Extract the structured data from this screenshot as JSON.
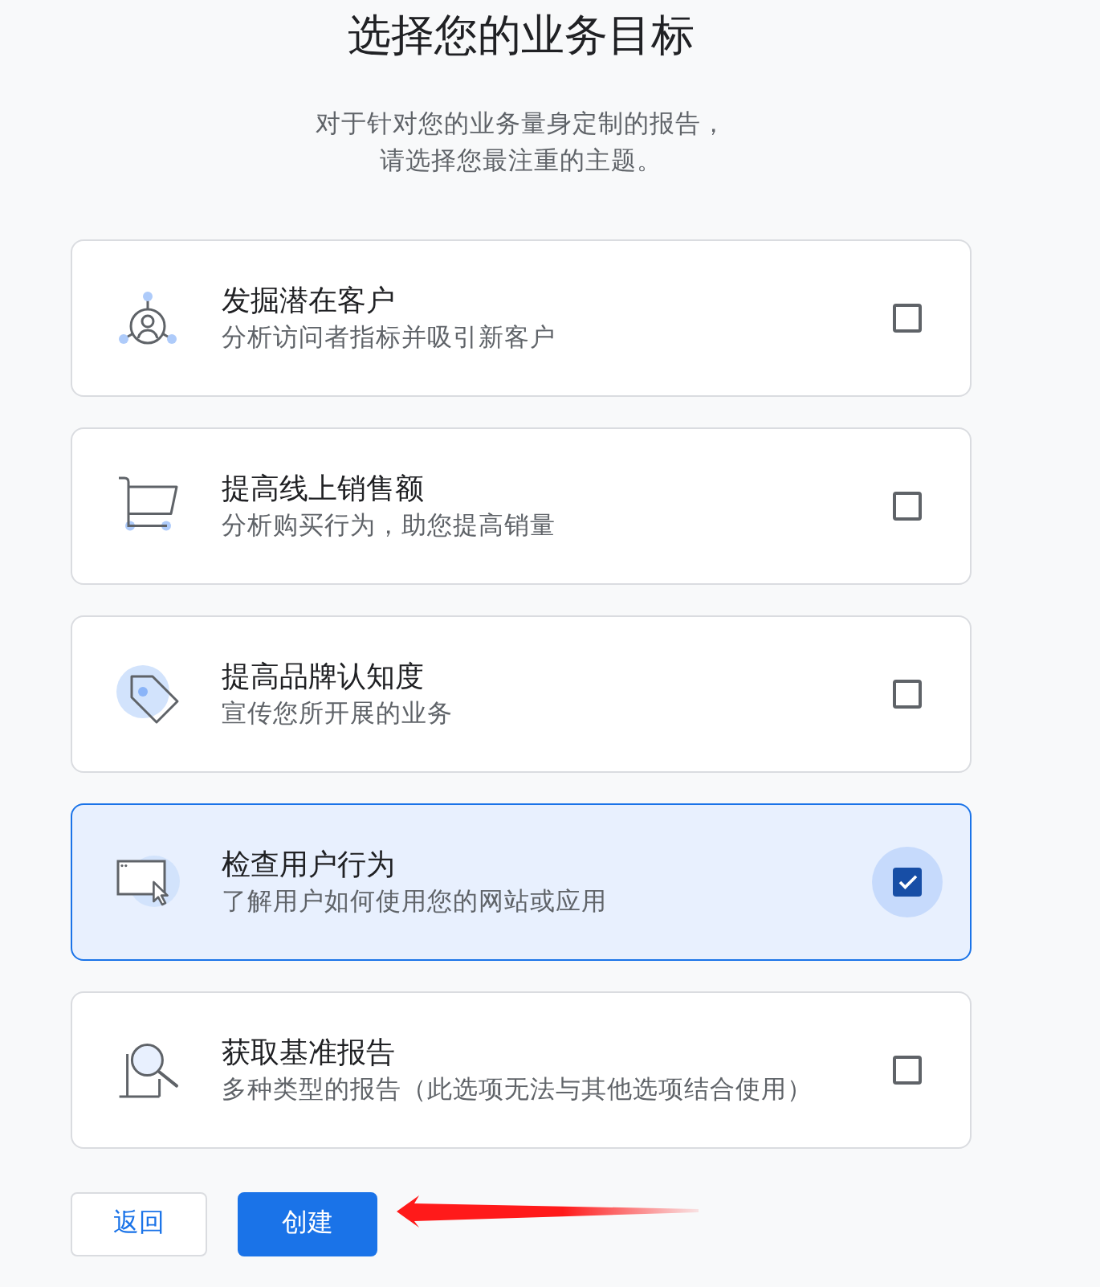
{
  "heading": {
    "title": "选择您的业务目标",
    "subtitle": [
      "对于针对您的业务量身定制的报告，",
      "请选择您最注重的主题。"
    ]
  },
  "goals": [
    {
      "kind": "network",
      "title": "发掘潜在客户",
      "description": "分析访问者指标并吸引新客户",
      "checked": false
    },
    {
      "kind": "cart",
      "title": "提高线上销售额",
      "description": "分析购买行为，助您提高销量",
      "checked": false
    },
    {
      "kind": "tag",
      "title": "提高品牌认知度",
      "description": "宣传您所开展的业务",
      "checked": false
    },
    {
      "kind": "window",
      "title": "检查用户行为",
      "description": "了解用户如何使用您的网站或应用",
      "checked": true
    },
    {
      "kind": "magnifier",
      "title": "获取基准报告",
      "description": "多种类型的报告（此选项无法与其他选项结合使用）",
      "checked": false
    }
  ],
  "buttons": [
    {
      "kind": "secondary",
      "label": "返回"
    },
    {
      "kind": "primary",
      "label": "创建"
    }
  ]
}
